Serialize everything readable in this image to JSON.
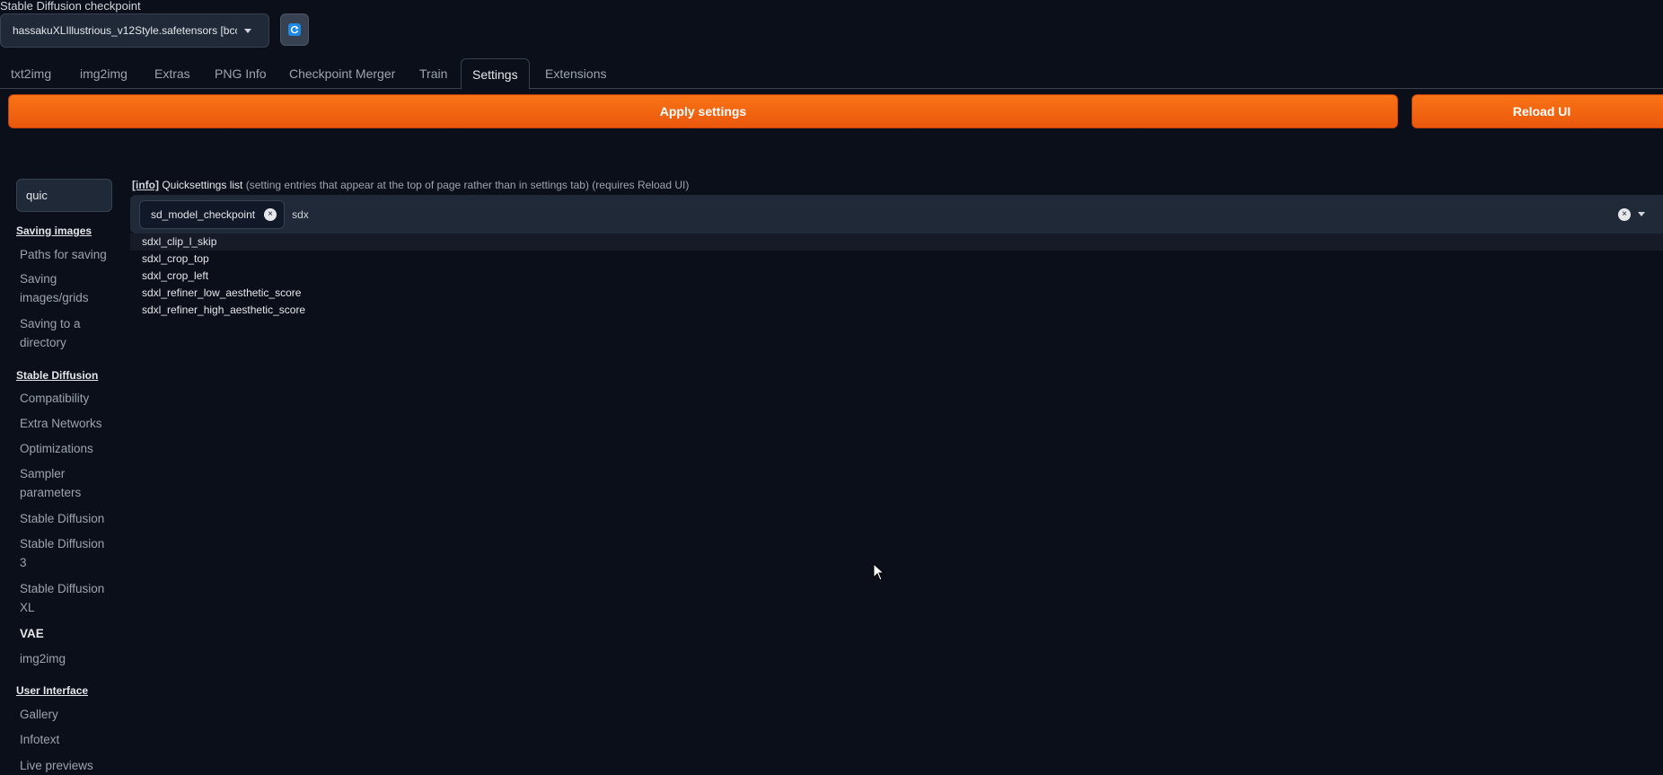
{
  "checkpoint": {
    "label": "Stable Diffusion checkpoint",
    "value": "hassakuXLIllustrious_v12Style.safetensors [bcc"
  },
  "tabs": [
    {
      "label": "txt2img"
    },
    {
      "label": "img2img"
    },
    {
      "label": "Extras"
    },
    {
      "label": "PNG Info"
    },
    {
      "label": "Checkpoint Merger"
    },
    {
      "label": "Train"
    },
    {
      "label": "Settings",
      "active": true
    },
    {
      "label": "Extensions"
    }
  ],
  "buttons": {
    "apply": "Apply settings",
    "reload": "Reload UI"
  },
  "search": {
    "value": "quic"
  },
  "sidebar": {
    "saving_header": "Saving images",
    "paths": "Paths for saving",
    "saving_grids_1": "Saving",
    "saving_grids_2": "images/grids",
    "saving_dir_1": "Saving to a",
    "saving_dir_2": "directory",
    "sd_header": "Stable Diffusion",
    "compat": "Compatibility",
    "extra_networks": "Extra Networks",
    "optimizations": "Optimizations",
    "sampler_1": "Sampler",
    "sampler_2": "parameters",
    "stable_diffusion": "Stable Diffusion",
    "sd3_1": "Stable Diffusion",
    "sd3_2": "3",
    "sdxl_1": "Stable Diffusion",
    "sdxl_2": "XL",
    "vae": "VAE",
    "img2img": "img2img",
    "ui_header": "User Interface",
    "gallery": "Gallery",
    "infotext": "Infotext",
    "live_previews": "Live previews"
  },
  "setting": {
    "info_tag": "[info]",
    "title": "Quicksettings list",
    "desc": "(setting entries that appear at the top of page rather than in settings tab) (requires Reload UI)",
    "token": "sd_model_checkpoint",
    "input": "sdx",
    "options": [
      "sdxl_clip_l_skip",
      "sdxl_crop_top",
      "sdxl_crop_left",
      "sdxl_refiner_low_aesthetic_score",
      "sdxl_refiner_high_aesthetic_score"
    ]
  },
  "colors": {
    "accent_orange": "#f97316",
    "background": "#0b0f19",
    "panel": "#1f2937"
  }
}
